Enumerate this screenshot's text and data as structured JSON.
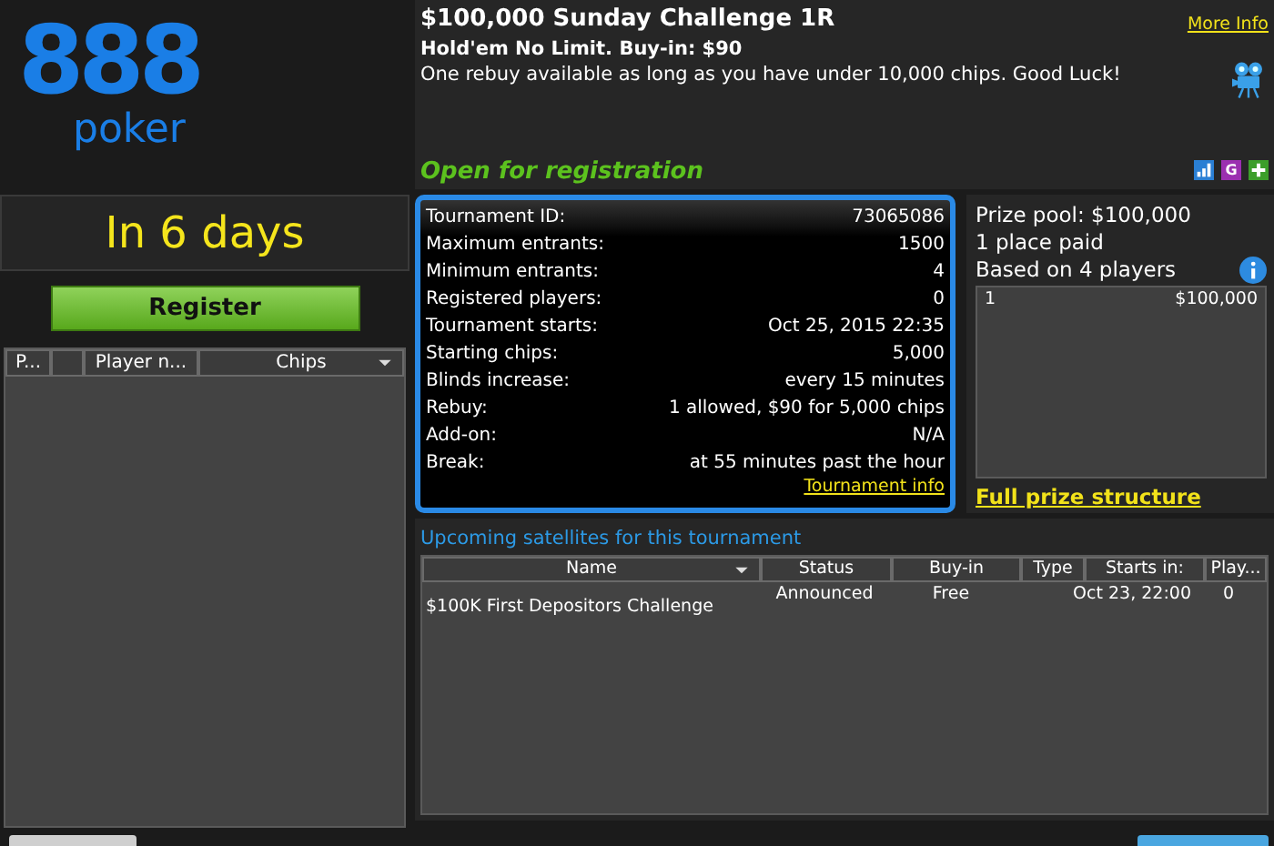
{
  "logo": {
    "mark": "888",
    "word": "poker"
  },
  "countdown": "In 6 days",
  "register_button": "Register",
  "players_table": {
    "columns": [
      {
        "kind": "text",
        "label": "P...",
        "sorted": false
      },
      {
        "kind": "blank",
        "sorted": false
      },
      {
        "kind": "text",
        "label": "Player n...",
        "sorted": false
      },
      {
        "kind": "text",
        "label": "Chips",
        "sorted": true
      }
    ]
  },
  "tournament": {
    "title": "$100,000 Sunday Challenge 1R",
    "subtitle": "Hold'em No Limit. Buy-in: $90",
    "description": "One rebuy available as long as you have under 10,000 chips. Good Luck!",
    "more_info_link": "More Info",
    "status": "Open for registration"
  },
  "toolbar_icons": [
    {
      "kind": "stats"
    },
    {
      "kind": "letter",
      "text": "G"
    },
    {
      "kind": "plus"
    }
  ],
  "details": [
    {
      "label": "Tournament ID:",
      "value": "73065086"
    },
    {
      "label": "Maximum entrants:",
      "value": "1500"
    },
    {
      "label": "Minimum entrants:",
      "value": "4"
    },
    {
      "label": "Registered players:",
      "value": "0"
    },
    {
      "label": "Tournament starts:",
      "value": "Oct 25, 2015 22:35"
    },
    {
      "label": "Starting chips:",
      "value": "5,000"
    },
    {
      "label": "Blinds increase:",
      "value": "every 15 minutes"
    },
    {
      "label": "Rebuy:",
      "value": "1 allowed, $90 for 5,000 chips"
    },
    {
      "label": "Add-on:",
      "value": "N/A"
    },
    {
      "label": "Break:",
      "value": "at 55 minutes past the hour"
    }
  ],
  "details_link": "Tournament info",
  "prize": {
    "pool": "Prize pool: $100,000",
    "places": "1 place paid",
    "basis": "Based on 4 players",
    "rows": [
      {
        "place": "1",
        "amount": "$100,000"
      }
    ],
    "link": "Full prize structure"
  },
  "satellites": {
    "title": "Upcoming satellites for this tournament",
    "columns": [
      {
        "label": "Name",
        "sorted": true
      },
      {
        "label": "Status",
        "sorted": false
      },
      {
        "label": "Buy-in",
        "sorted": false
      },
      {
        "label": "Type",
        "sorted": false
      },
      {
        "label": "Starts in:",
        "sorted": false
      },
      {
        "label": "Play...",
        "sorted": false
      }
    ],
    "rows": [
      {
        "name": "$100K First Depositors Challenge",
        "status": "Announced",
        "buy_in": "Free",
        "starts_in": "Oct 23, 22:00",
        "players": "0"
      }
    ]
  }
}
